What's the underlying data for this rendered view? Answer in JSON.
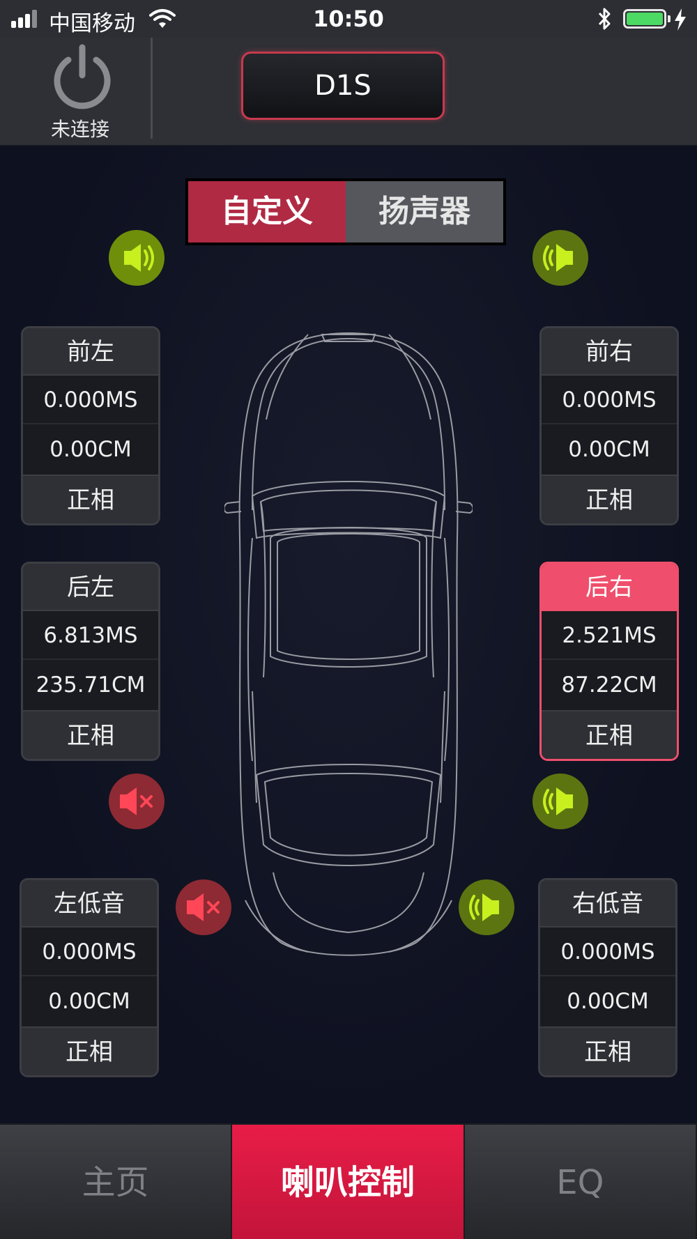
{
  "status_bar": {
    "carrier": "中国移动",
    "time": "10:50"
  },
  "header": {
    "connection_status": "未连接",
    "device_name": "D1S"
  },
  "mode_tabs": {
    "custom": "自定义",
    "speaker": "扬声器"
  },
  "channels": {
    "front_left": {
      "name": "前左",
      "delay": "0.000MS",
      "distance": "0.00CM",
      "phase": "正相",
      "speaker": "on"
    },
    "front_right": {
      "name": "前右",
      "delay": "0.000MS",
      "distance": "0.00CM",
      "phase": "正相",
      "speaker": "on"
    },
    "rear_left": {
      "name": "后左",
      "delay": "6.813MS",
      "distance": "235.71CM",
      "phase": "正相",
      "speaker": "muted"
    },
    "rear_right": {
      "name": "后右",
      "delay": "2.521MS",
      "distance": "87.22CM",
      "phase": "正相",
      "speaker": "on",
      "selected": true
    },
    "sub_left": {
      "name": "左低音",
      "delay": "0.000MS",
      "distance": "0.00CM",
      "phase": "正相",
      "speaker": "muted"
    },
    "sub_right": {
      "name": "右低音",
      "delay": "0.000MS",
      "distance": "0.00CM",
      "phase": "正相",
      "speaker": "on"
    }
  },
  "tabbar": {
    "home": "主页",
    "speaker_control": "喇叭控制",
    "eq": "EQ"
  },
  "colors": {
    "accent": "#e81d47",
    "speaker_on": "#6f8f0b",
    "speaker_muted": "#8e2a33",
    "selected_border": "#ef4f6c"
  }
}
